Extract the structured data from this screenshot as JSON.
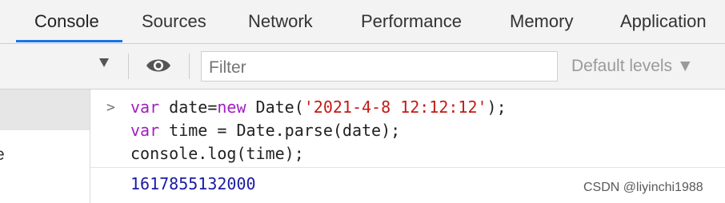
{
  "tabs": [
    {
      "label": "Console"
    },
    {
      "label": "Sources"
    },
    {
      "label": "Network"
    },
    {
      "label": "Performance"
    },
    {
      "label": "Memory"
    },
    {
      "label": "Application"
    }
  ],
  "active_tab": "Console",
  "toolbar": {
    "filter_placeholder": "Filter",
    "levels_label": "Default levels ▼",
    "icons": [
      "dropdown-arrow-icon",
      "eye-icon"
    ]
  },
  "console": {
    "prompt": ">",
    "code": [
      {
        "keyword": "var",
        "rest_a": " date=",
        "keyword2": "new",
        "rest_b": " Date(",
        "string": "'2021-4-8 12:12:12'",
        "rest_c": ");"
      },
      {
        "keyword": "var",
        "rest_a": " time = Date.parse(date);"
      },
      {
        "rest_a": "console.log(time);"
      }
    ],
    "result": "1617855132000"
  },
  "sidebar": {
    "partial_letter": "e"
  },
  "watermark": "CSDN @liyinchi1988",
  "colors": {
    "keyword": "#a21ec0",
    "string": "#c41a16",
    "result": "#1a1aa6",
    "active_tab_underline": "#1a73e8"
  }
}
